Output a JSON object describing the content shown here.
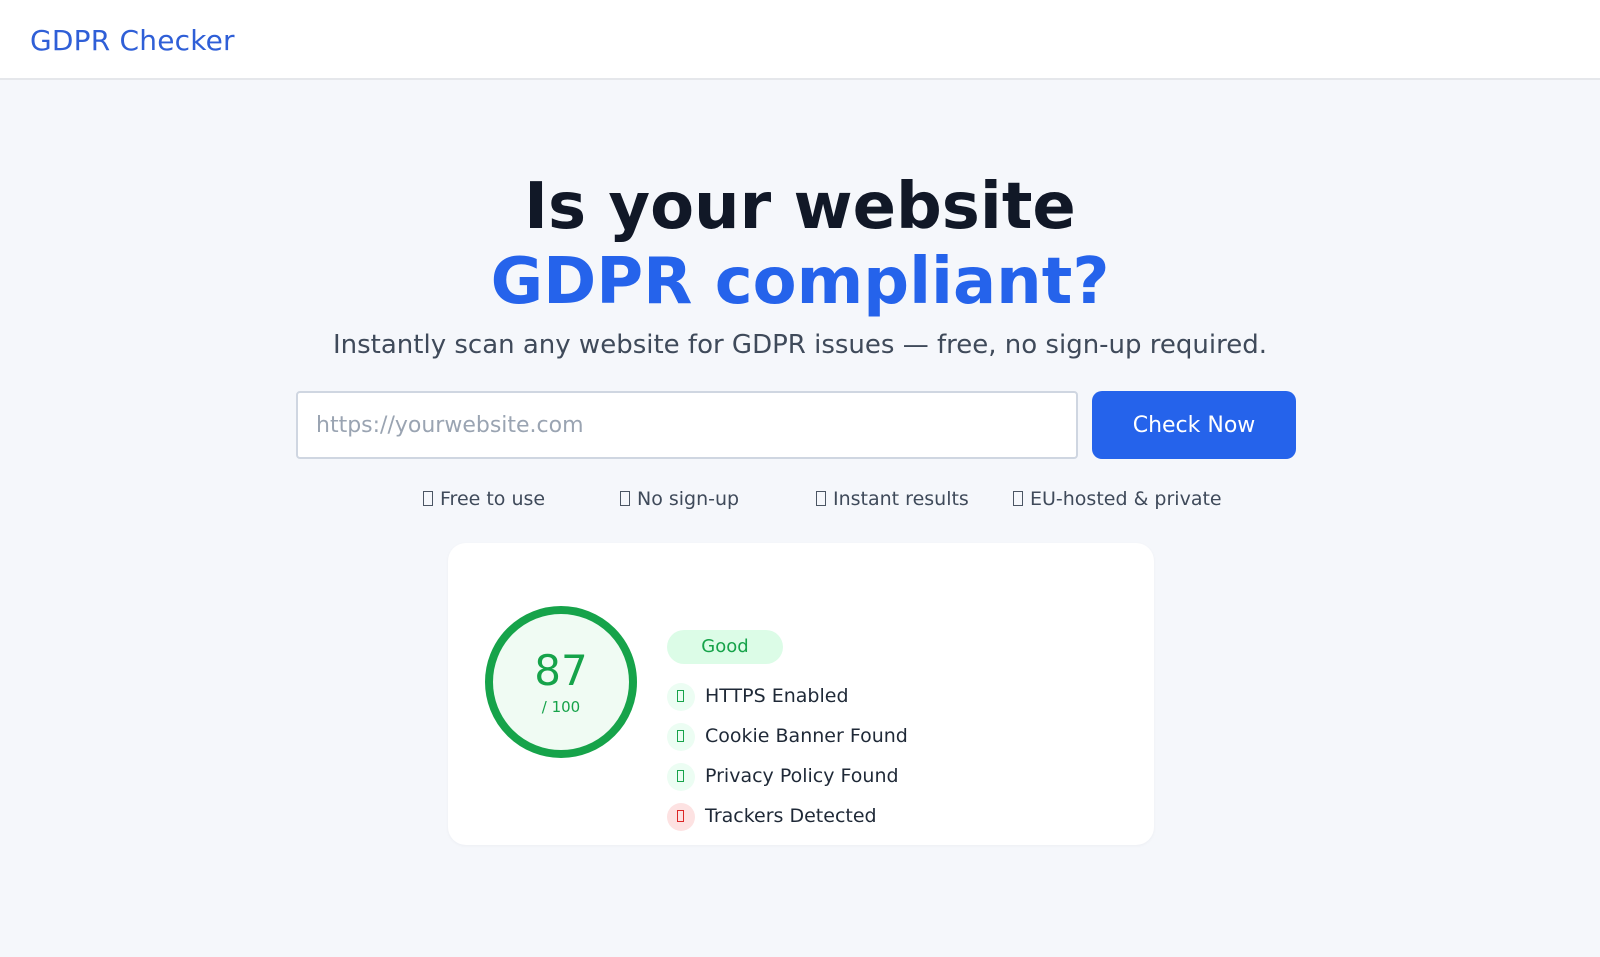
{
  "header": {
    "brand": "GDPR Checker"
  },
  "hero": {
    "title_line1": "Is your website",
    "title_line2": "GDPR compliant?",
    "subtitle": "Instantly scan any website for GDPR issues — free, no sign-up required."
  },
  "search": {
    "placeholder": "https://yourwebsite.com",
    "value": "",
    "button_label": "Check Now"
  },
  "features": [
    {
      "label": "Free to use"
    },
    {
      "label": "No sign-up"
    },
    {
      "label": "Instant results"
    },
    {
      "label": "EU-hosted & private"
    }
  ],
  "result": {
    "score": "87",
    "max": "/ 100",
    "rating": "Good",
    "checks": [
      {
        "label": "HTTPS Enabled",
        "status": "pass"
      },
      {
        "label": "Cookie Banner Found",
        "status": "pass"
      },
      {
        "label": "Privacy Policy Found",
        "status": "pass"
      },
      {
        "label": "Trackers Detected",
        "status": "fail"
      }
    ]
  },
  "colors": {
    "accent": "#2563eb",
    "brand": "#2f5fd7",
    "good": "#16a34a",
    "good_bg": "#dcfce7",
    "fail": "#dc2626",
    "fail_bg": "#fde2e2"
  }
}
